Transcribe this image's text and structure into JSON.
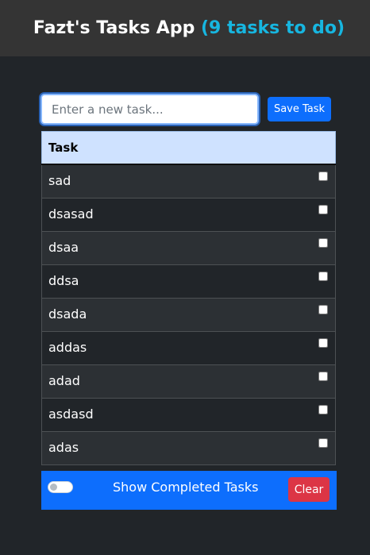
{
  "header": {
    "title": "Fazt's Tasks App",
    "count_text": "(9 tasks to do)"
  },
  "form": {
    "placeholder": "Enter a new task...",
    "value": "",
    "save_label": "Save Task"
  },
  "table": {
    "header": "Task",
    "tasks": [
      {
        "label": "sad",
        "done": false
      },
      {
        "label": "dsasad",
        "done": false
      },
      {
        "label": "dsaa",
        "done": false
      },
      {
        "label": "ddsa",
        "done": false
      },
      {
        "label": "dsada",
        "done": false
      },
      {
        "label": "addas",
        "done": false
      },
      {
        "label": "adad",
        "done": false
      },
      {
        "label": "asdasd",
        "done": false
      },
      {
        "label": "adas",
        "done": false
      }
    ]
  },
  "footer": {
    "toggle_label": "Show Completed Tasks",
    "toggle_on": false,
    "clear_label": "Clear"
  },
  "colors": {
    "background": "#212529",
    "navbar": "#343434",
    "accent": "#17b6e0",
    "primary": "#0d6efd",
    "danger": "#dc3545",
    "table_header": "#cfe2ff"
  }
}
